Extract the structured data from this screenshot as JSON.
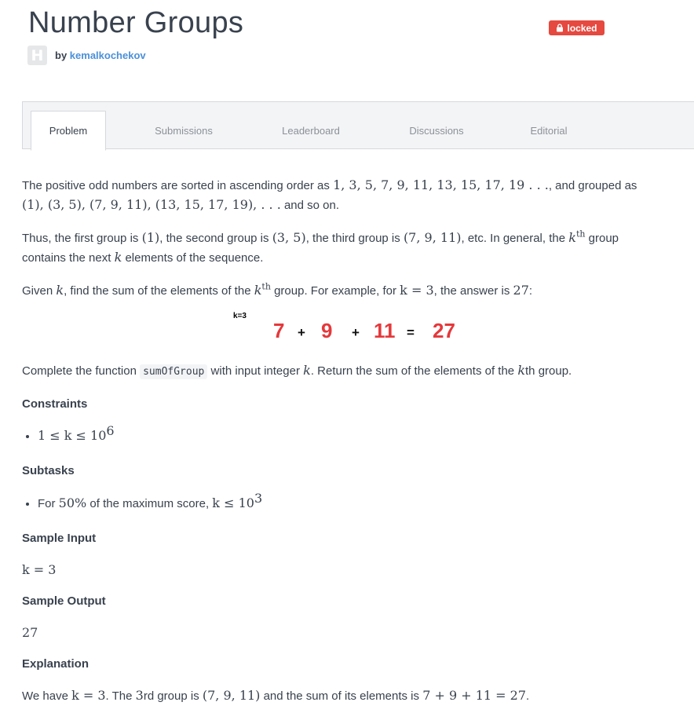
{
  "header": {
    "title": "Number Groups",
    "badge_label": "locked",
    "by_label": "by",
    "author": "kemalkochekov",
    "avatar_letter": "H"
  },
  "tabs": [
    {
      "label": "Problem",
      "active": true
    },
    {
      "label": "Submissions",
      "active": false
    },
    {
      "label": "Leaderboard",
      "active": false
    },
    {
      "label": "Discussions",
      "active": false
    },
    {
      "label": "Editorial",
      "active": false
    }
  ],
  "statement": {
    "p1_a": "The positive odd numbers are sorted in ascending order as ",
    "p1_seq": "1, 3, 5, 7, 9, 11, 13, 15, 17, 19 . . .",
    "p1_b": ", and grouped as",
    "p1_groups": "(1), (3, 5), (7, 9, 11), (13, 15, 17, 19), . . .",
    "p1_c": " and so on.",
    "p2_a": "Thus, the first group is ",
    "p2_g1": "(1)",
    "p2_b": ", the second group is ",
    "p2_g2": "(3, 5)",
    "p2_c": ", the third group is ",
    "p2_g3": "(7, 9, 11)",
    "p2_d": ", etc. In general, the ",
    "p2_k": "k",
    "p2_th": "th",
    "p2_e": " group",
    "p2_f": "contains the next ",
    "p2_k2": "k",
    "p2_g": " elements of the sequence.",
    "p3_a": "Given ",
    "p3_k": "k",
    "p3_b": ", find the sum of the elements of the ",
    "p3_k2": "k",
    "p3_th": "th",
    "p3_c": " group. For example, for ",
    "p3_eq": "k = 3",
    "p3_d": ", the answer is ",
    "p3_ans": "27",
    "p3_e": ":"
  },
  "example_image": {
    "k_label": "k=3",
    "n1": "7",
    "plus1": "+",
    "n2": "9",
    "plus2": "+",
    "n3": "11",
    "eq": "=",
    "result": "27"
  },
  "task": {
    "a": "Complete the function ",
    "func": "sumOfGroup",
    "b": " with input integer ",
    "k": "k",
    "c": ". Return the sum of the elements of the ",
    "k2": "k",
    "d": "th group."
  },
  "constraints": {
    "heading": "Constraints",
    "item": "1 ≤ k ≤ 10",
    "exp": "6"
  },
  "subtasks": {
    "heading": "Subtasks",
    "a": "For ",
    "pct": "50%",
    "b": " of the maximum score, ",
    "expr": "k ≤ 10",
    "exp": "3"
  },
  "sample_input": {
    "heading": "Sample Input",
    "value": "k = 3"
  },
  "sample_output": {
    "heading": "Sample Output",
    "value": "27"
  },
  "explanation": {
    "heading": "Explanation",
    "a": "We have ",
    "eq": "k = 3",
    "b": ". The ",
    "n": "3",
    "c": "rd group is ",
    "grp": "(7, 9, 11)",
    "d": " and the sum of its elements is ",
    "sum": "7 + 9 + 11 = 27",
    "e": "."
  }
}
